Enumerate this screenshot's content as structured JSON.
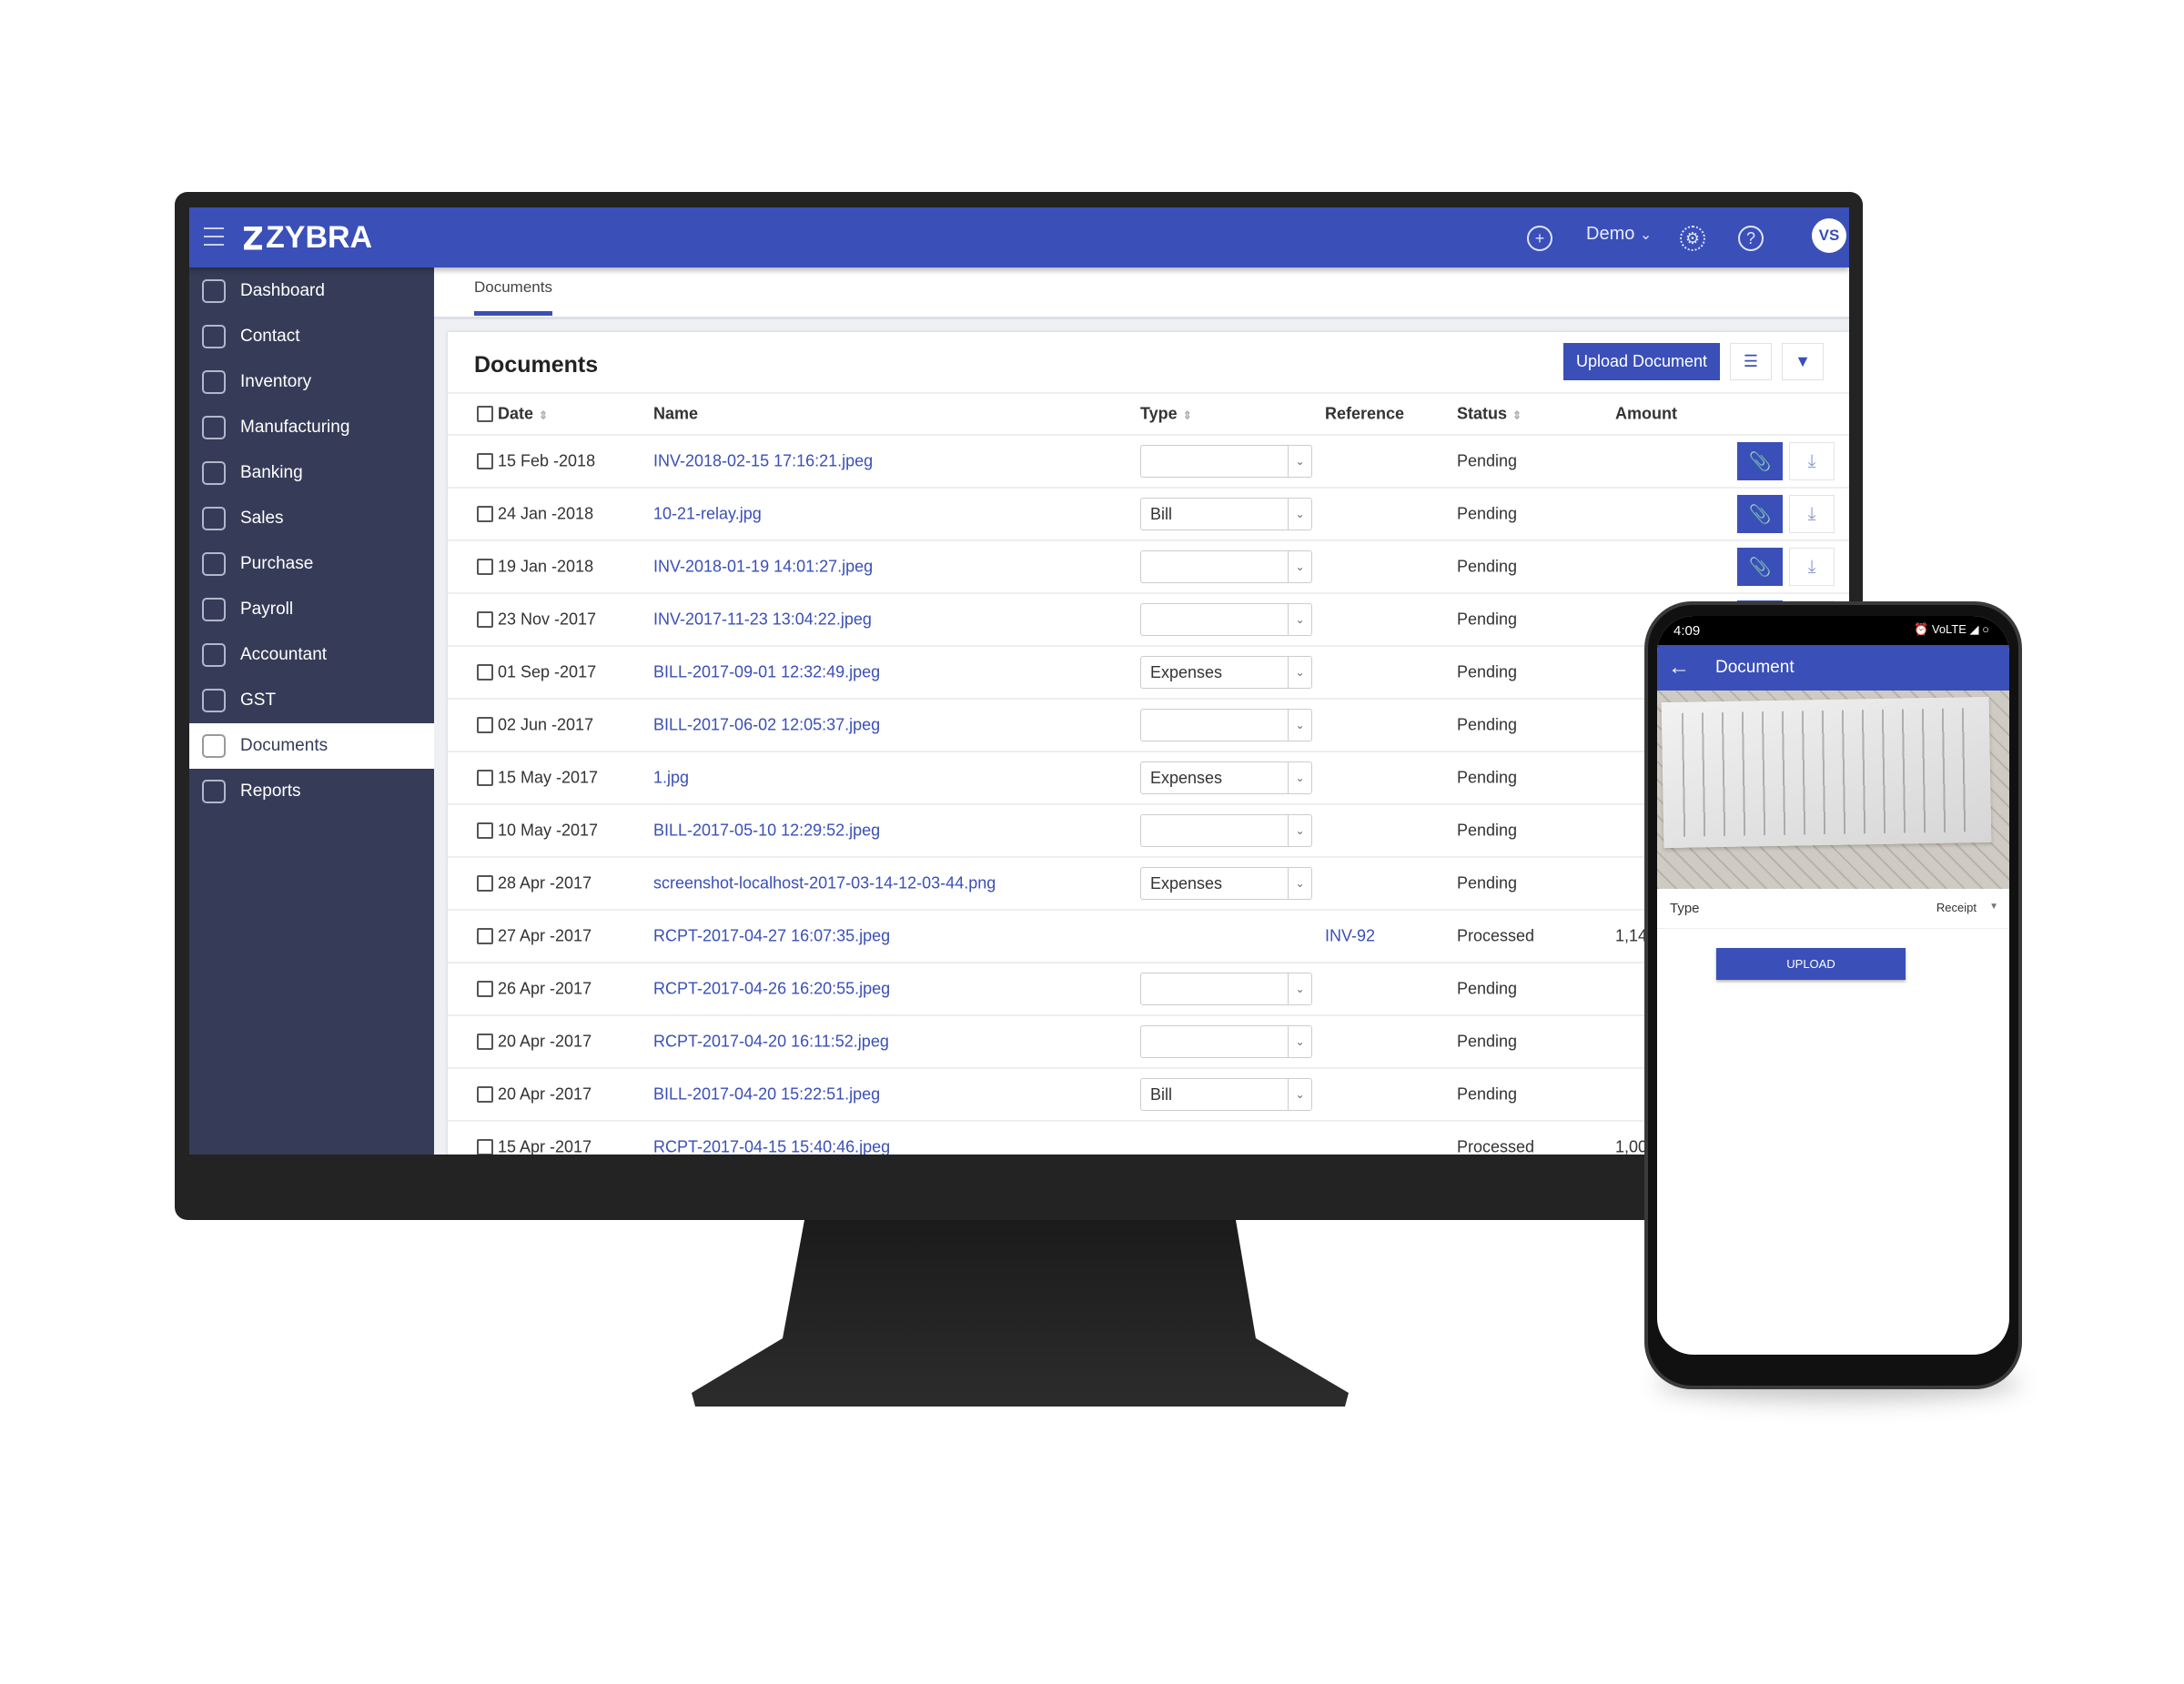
{
  "brand": {
    "name": "ZYBRA",
    "accent": "#3a4fb7",
    "sidebar_bg": "#363c57"
  },
  "topbar": {
    "add_icon": "plus-circle-icon",
    "company": "Demo",
    "settings_icon": "gear-icon",
    "help_icon": "help-icon",
    "avatar": "VS"
  },
  "sidebar": {
    "items": [
      {
        "label": "Dashboard",
        "icon": "dashboard-icon"
      },
      {
        "label": "Contact",
        "icon": "contact-icon"
      },
      {
        "label": "Inventory",
        "icon": "inventory-icon"
      },
      {
        "label": "Manufacturing",
        "icon": "manufacturing-icon"
      },
      {
        "label": "Banking",
        "icon": "bank-icon"
      },
      {
        "label": "Sales",
        "icon": "cart-icon"
      },
      {
        "label": "Purchase",
        "icon": "bag-icon"
      },
      {
        "label": "Payroll",
        "icon": "payroll-icon"
      },
      {
        "label": "Accountant",
        "icon": "accountant-icon"
      },
      {
        "label": "GST",
        "icon": "gst-icon"
      },
      {
        "label": "Documents",
        "icon": "document-icon",
        "active": true
      },
      {
        "label": "Reports",
        "icon": "reports-icon"
      }
    ]
  },
  "tabs": [
    {
      "label": "Documents"
    }
  ],
  "panel": {
    "title": "Documents",
    "upload_label": "Upload Document"
  },
  "table": {
    "headers": {
      "date": "Date",
      "name": "Name",
      "type": "Type",
      "reference": "Reference",
      "status": "Status",
      "amount": "Amount"
    },
    "rows": [
      {
        "date": "15 Feb -2018",
        "name": "INV-2018-02-15 17:16:21.jpeg",
        "type": "",
        "reference": "",
        "status": "Pending",
        "amount": "",
        "select": true
      },
      {
        "date": "24 Jan -2018",
        "name": "10-21-relay.jpg",
        "type": "Bill",
        "reference": "",
        "status": "Pending",
        "amount": "",
        "select": true
      },
      {
        "date": "19 Jan -2018",
        "name": "INV-2018-01-19 14:01:27.jpeg",
        "type": "",
        "reference": "",
        "status": "Pending",
        "amount": "",
        "select": true
      },
      {
        "date": "23 Nov -2017",
        "name": "INV-2017-11-23 13:04:22.jpeg",
        "type": "",
        "reference": "",
        "status": "Pending",
        "amount": "",
        "select": true
      },
      {
        "date": "01 Sep -2017",
        "name": "BILL-2017-09-01 12:32:49.jpeg",
        "type": "Expenses",
        "reference": "",
        "status": "Pending",
        "amount": "",
        "select": true
      },
      {
        "date": "02 Jun -2017",
        "name": "BILL-2017-06-02 12:05:37.jpeg",
        "type": "",
        "reference": "",
        "status": "Pending",
        "amount": "",
        "select": true
      },
      {
        "date": "15 May -2017",
        "name": "1.jpg",
        "type": "Expenses",
        "reference": "",
        "status": "Pending",
        "amount": "",
        "select": true
      },
      {
        "date": "10 May -2017",
        "name": "BILL-2017-05-10 12:29:52.jpeg",
        "type": "",
        "reference": "",
        "status": "Pending",
        "amount": "",
        "select": true
      },
      {
        "date": "28 Apr -2017",
        "name": "screenshot-localhost-2017-03-14-12-03-44.png",
        "type": "Expenses",
        "reference": "",
        "status": "Pending",
        "amount": "",
        "select": true
      },
      {
        "date": "27 Apr -2017",
        "name": "RCPT-2017-04-27 16:07:35.jpeg",
        "type": "",
        "reference": "INV-92",
        "status": "Processed",
        "amount": "1,14",
        "select": false
      },
      {
        "date": "26 Apr -2017",
        "name": "RCPT-2017-04-26 16:20:55.jpeg",
        "type": "",
        "reference": "",
        "status": "Pending",
        "amount": "",
        "select": true
      },
      {
        "date": "20 Apr -2017",
        "name": "RCPT-2017-04-20 16:11:52.jpeg",
        "type": "",
        "reference": "",
        "status": "Pending",
        "amount": "",
        "select": true
      },
      {
        "date": "20 Apr -2017",
        "name": "BILL-2017-04-20 15:22:51.jpeg",
        "type": "Bill",
        "reference": "",
        "status": "Pending",
        "amount": "",
        "select": true
      },
      {
        "date": "15 Apr -2017",
        "name": "RCPT-2017-04-15 15:40:46.jpeg",
        "type": "",
        "reference": "",
        "status": "Processed",
        "amount": "1,00",
        "select": false
      }
    ]
  },
  "phone": {
    "time": "4:09",
    "status_icons": "⏰ VoLTE ◢ ○",
    "title": "Document",
    "type_label": "Type",
    "type_value": "Receipt",
    "upload_label": "UPLOAD"
  }
}
